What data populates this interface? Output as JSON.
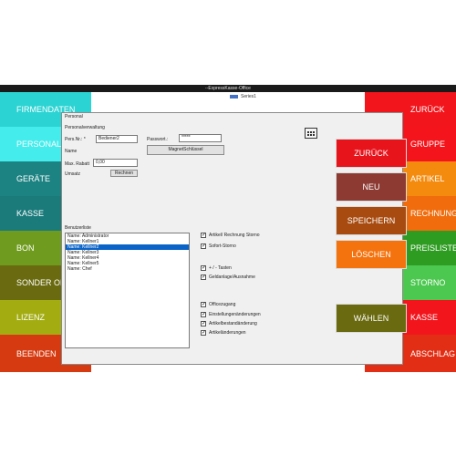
{
  "window": {
    "title": "--ExpressKasse-Office"
  },
  "left_menu": [
    {
      "label": "FIRMENDATEN",
      "color": "#2bd3d3"
    },
    {
      "label": "PERSONAL",
      "color": "#45ecec"
    },
    {
      "label": "GERÄTE",
      "color": "#1d8282"
    },
    {
      "label": "KASSE",
      "color": "#1b7b7b"
    },
    {
      "label": "BON",
      "color": "#6f9c1e"
    },
    {
      "label": "SONDER OPTIONEN",
      "color": "#6a6a10"
    },
    {
      "label": "LIZENZ",
      "color": "#a3ad12"
    },
    {
      "label": "BEENDEN",
      "color": "#d63a10"
    }
  ],
  "right_menu": [
    {
      "label": "ZURÜCK",
      "color": "#f2151c"
    },
    {
      "label": "GRUPPE",
      "color": "#f4151c"
    },
    {
      "label": "ARTIKEL",
      "color": "#f48b0e"
    },
    {
      "label": "RECHNUNG",
      "color": "#f06c0c"
    },
    {
      "label": "PREISLISTE",
      "color": "#2d9c21"
    },
    {
      "label": "STORNO",
      "color": "#4cc850"
    },
    {
      "label": "KASSE",
      "color": "#f2151c"
    },
    {
      "label": "ABSCHLAG",
      "color": "#e22e14"
    }
  ],
  "chart": {
    "legend": "Series1"
  },
  "dialog": {
    "title": "Personal",
    "group_label": "Personalverwaltung",
    "persnr_label": "Pers.Nr.: *",
    "persnr_value": "Bediener2",
    "password_label": "Passwort.:",
    "password_value": "*****",
    "name_label": "Name",
    "magnet_button": "MagnetSchlüssel",
    "rabatt_label": "Max. Rabatt",
    "rabatt_value": "0,00",
    "umsatz_label": "Umsatz",
    "umsatz_button": "Rechnen",
    "userlist_label": "Benutzerliste",
    "users": [
      {
        "label": "Name: Administrator",
        "selected": false
      },
      {
        "label": "Name: Kellner1",
        "selected": false
      },
      {
        "label": "Name: Kellner2",
        "selected": true
      },
      {
        "label": "Name: Kellner3",
        "selected": false
      },
      {
        "label": "Name: Kellner4",
        "selected": false
      },
      {
        "label": "Name: Kellner5",
        "selected": false
      },
      {
        "label": "Name: Chef",
        "selected": false
      }
    ],
    "checks": [
      {
        "label": "Artikel/ Rechnung Storno",
        "checked": true
      },
      {
        "label": "Sofort-Storno",
        "checked": true
      },
      {
        "label": "+ / - Tasten",
        "checked": true
      },
      {
        "label": "Geldanlage/Ausnahme",
        "checked": true
      },
      {
        "label": "Officezugang",
        "checked": true
      },
      {
        "label": "Einstellungenänderungen",
        "checked": true
      },
      {
        "label": "Artikelbestandänderung",
        "checked": true
      },
      {
        "label": "Artikeländerungen",
        "checked": true
      }
    ],
    "actions": [
      {
        "label": "ZURÜCK",
        "color": "#e8141c"
      },
      {
        "label": "NEU",
        "color": "#8c3a32"
      },
      {
        "label": "SPEICHERN",
        "color": "#a84b10"
      },
      {
        "label": "LÖSCHEN",
        "color": "#f4730e"
      },
      {
        "label": "WÄHLEN",
        "color": "#6a6a10"
      }
    ]
  }
}
